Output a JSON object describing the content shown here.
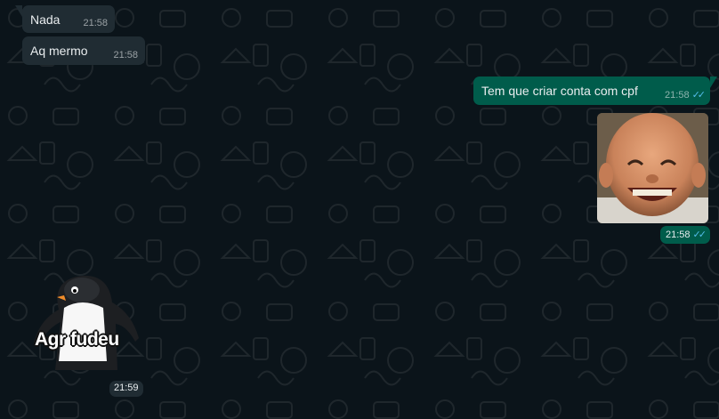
{
  "messages": [
    {
      "direction": "incoming",
      "text": "Nada",
      "time": "21:58"
    },
    {
      "direction": "incoming",
      "text": "Aq mermo",
      "time": "21:58"
    },
    {
      "direction": "outgoing",
      "text": "Tem que criar conta com cpf",
      "time": "21:58",
      "status": "read"
    },
    {
      "direction": "outgoing",
      "type": "image",
      "content": "smiling baby face photo",
      "time": "21:58",
      "status": "read"
    },
    {
      "direction": "incoming",
      "type": "sticker",
      "content": "penguin sticker",
      "caption": "Agr fudeu",
      "time": "21:59"
    }
  ],
  "icons": {
    "read_receipt": "double-check-icon"
  },
  "colors": {
    "background": "#0b141a",
    "incoming_bubble": "#202c33",
    "outgoing_bubble": "#005c4b",
    "read_tick": "#53bdeb",
    "text": "#e9edef"
  }
}
